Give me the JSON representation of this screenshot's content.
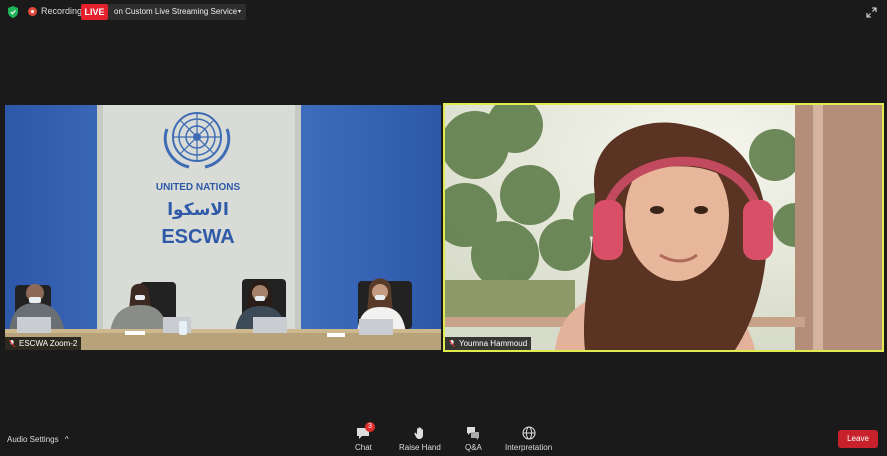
{
  "meeting": {
    "recording_label": "Recording",
    "live_label": "LIVE",
    "streaming_label": "on Custom Live Streaming Service",
    "streaming_caret": "▾"
  },
  "tiles": [
    {
      "name": "ESCWA Zoom-2",
      "backdrop": {
        "org_line1": "UNITED NATIONS",
        "org_arabic": "الاسكوا",
        "org_line2": "ESCWA"
      }
    },
    {
      "name": "Youmna Hammoud",
      "active_speaker": true
    }
  ],
  "toolbar": {
    "audio_settings": "Audio Settings",
    "audio_caret": "^",
    "chat_label": "Chat",
    "chat_badge": "3",
    "raise_hand_label": "Raise Hand",
    "qa_label": "Q&A",
    "interpretation_label": "Interpretation",
    "leave_label": "Leave"
  },
  "colors": {
    "background": "#1a1a1a",
    "live": "#e3202c",
    "active_border": "#e0ec4e",
    "leave": "#c7222c",
    "badge": "#e02b2b",
    "security_green": "#1fb35a"
  },
  "icons": [
    "shield-icon",
    "record-icon",
    "expand-icon",
    "mic-muted-icon",
    "chat-icon",
    "hand-icon",
    "qa-icon",
    "globe-icon"
  ]
}
